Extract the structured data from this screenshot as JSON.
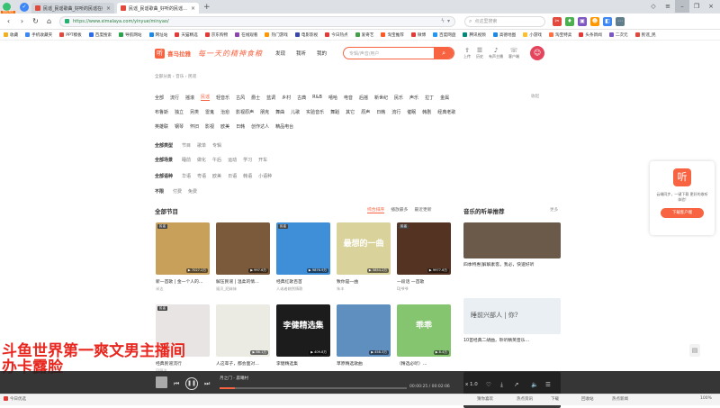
{
  "browser": {
    "brand_label": "随机浏览",
    "tabs": [
      {
        "title": "民谣_民谣歌曲_好听的民谣在线…",
        "active": false
      },
      {
        "title": "民谣_民谣歌曲_好听的民谣…",
        "active": true
      }
    ],
    "url": "https://www.ximalaya.com/yinyue/minyao/",
    "search_placeholder": "点这里搜索",
    "bookmarks": [
      {
        "label": "收藏",
        "color": "#f2b01e"
      },
      {
        "label": "手机收藏夹",
        "color": "#3d86f6"
      },
      {
        "label": "PPT模板",
        "color": "#e2483b"
      },
      {
        "label": "百度搜索",
        "color": "#2d6bea"
      },
      {
        "label": "导航网站",
        "color": "#27a44a"
      },
      {
        "label": "网址站",
        "color": "#1e88e5"
      },
      {
        "label": "天猫精选",
        "color": "#e53935"
      },
      {
        "label": "京东购物",
        "color": "#e53935"
      },
      {
        "label": "在线观看",
        "color": "#8e44ad"
      },
      {
        "label": "热门游戏",
        "color": "#ff9800"
      },
      {
        "label": "电影影视",
        "color": "#3949ab"
      },
      {
        "label": "今日热点",
        "color": "#e53935"
      },
      {
        "label": "爱奇艺",
        "color": "#43a047"
      },
      {
        "label": "淘宝推荐",
        "color": "#ff5722"
      },
      {
        "label": "微博",
        "color": "#e53935"
      },
      {
        "label": "百度网盘",
        "color": "#2196f3"
      },
      {
        "label": "腾讯视频",
        "color": "#00897b"
      },
      {
        "label": "高德地图",
        "color": "#1e88e5"
      },
      {
        "label": "小游戏",
        "color": "#fbc02d"
      },
      {
        "label": "淘宝特卖",
        "color": "#ff7043"
      },
      {
        "label": "头条新闻",
        "color": "#e53935"
      },
      {
        "label": "二次元",
        "color": "#7e57c2"
      },
      {
        "label": "民谣_民",
        "color": "#e2483b"
      }
    ]
  },
  "site": {
    "logo_glyph": "听",
    "logo_name": "喜马拉雅",
    "slogan": "每一天的精神食粮",
    "nav": [
      "发现",
      "我听",
      "我的"
    ],
    "search_placeholder": "专辑/声音/用户",
    "header_icons": [
      {
        "glyph": "⇪",
        "label": "上传"
      },
      {
        "glyph": "☰",
        "label": "历史"
      },
      {
        "glyph": "♪",
        "label": "有声主播"
      },
      {
        "glyph": "☏",
        "label": "客户端"
      }
    ],
    "avatar_glyph": "☺"
  },
  "breadcrumb": "全部分类 › 音乐 › 民谣",
  "genres_row1": [
    "全部",
    "流行",
    "摇滚",
    "民谣",
    "轻音乐",
    "古风",
    "爵士",
    "蓝调",
    "乡村",
    "古典",
    "R&B",
    "嘻哈",
    "电音",
    "后摇",
    "新世纪",
    "民乐",
    "声乐",
    "拉丁",
    "金属"
  ],
  "genres_row1_selected": "民谣",
  "genres_row2": [
    "布鲁斯",
    "独立",
    "另类",
    "雷鬼",
    "治愈",
    "影视原声",
    "朋克",
    "舞曲",
    "儿歌",
    "实验音乐",
    "舞蹈",
    "其它",
    "原声",
    "日韩",
    "流行",
    "催眠",
    "韩剧",
    "经典老歌"
  ],
  "genres_row3": [
    "英雄联",
    "钢琴",
    "怀旧",
    "影视",
    "欧美",
    "日韩",
    "创作达人",
    "精品电台"
  ],
  "expand_label": "收起",
  "filters": [
    {
      "label": "全部类型",
      "items": [
        "节目",
        "歌单",
        "专辑"
      ]
    },
    {
      "label": "全部场景",
      "items": [
        "睡前",
        "做化",
        "午后",
        "运动",
        "学习",
        "开车"
      ]
    },
    {
      "label": "全部语种",
      "items": [
        "华语",
        "粤语",
        "欧美",
        "日语",
        "韩语",
        "小语种"
      ]
    },
    {
      "label": "不限",
      "items": [
        "付费",
        "免费"
      ]
    }
  ],
  "section_all": "全部节目",
  "sort_tabs": [
    "综合排序",
    "播放最多",
    "最近更新"
  ],
  "sort_selected": "综合排序",
  "cards": [
    {
      "title": "新一首歌 | 金一个人的…",
      "author": "米达",
      "plays": "7027.2万",
      "bg": "#c8a05a",
      "tag": "民谣",
      "cover_text": ""
    },
    {
      "title": "解压民谣 | 温柔的情…",
      "author": "福贝_陌妹妹",
      "plays": "997.6万",
      "bg": "#7a5a3a",
      "tag": "",
      "cover_text": ""
    },
    {
      "title": "经典红歌百首",
      "author": "人或者婉然情歌",
      "plays": "9876.9万",
      "bg": "#3f8fd8",
      "tag": "民谣",
      "cover_text": ""
    },
    {
      "title": "致你是一曲",
      "author": "朱丰",
      "plays": "5854.2万",
      "bg": "#d9d29a",
      "tag": "",
      "cover_text": "最想的一曲"
    },
    {
      "title": "一段话 一首歌",
      "author": "DJ爷爷",
      "plays": "9977.6万",
      "bg": "#553322",
      "tag": "民谣",
      "cover_text": ""
    },
    {
      "title": "经典民谣流行",
      "author": "贝丽达",
      "plays": "",
      "bg": "#e9e4e4",
      "tag": "民谣",
      "cover_text": ""
    },
    {
      "title": "人这辈子，都会面对…",
      "author": "",
      "plays": "86.1万",
      "bg": "#ecebe3",
      "tag": "",
      "cover_text": ""
    },
    {
      "title": "李健精选集",
      "author": "",
      "plays": "409.8万",
      "bg": "#1c1c1c",
      "tag": "",
      "cover_text": "李健精选集"
    },
    {
      "title": "草原精选歌曲",
      "author": "",
      "plays": "458.3万",
      "bg": "#5f8fbf",
      "tag": "",
      "cover_text": ""
    },
    {
      "title": "（精选必听）…",
      "author": "",
      "plays": "8.4万",
      "bg": "#86c56f",
      "tag": "",
      "cover_text": "乖乖"
    }
  ],
  "section_rec": "音乐的听单推荐",
  "more_label": "更多",
  "recs": [
    {
      "title": "四季特惠|解解素客。我必，快速好听",
      "bg": "#6b5a4a",
      "cover_text": ""
    },
    {
      "title": "10首经典二胡曲，聆听精英音乐…",
      "bg": "#e9eff2",
      "cover_text": "睡前兴部人 | 你?"
    },
    {
      "title": "",
      "bg": "#3a3a3a",
      "cover_text": ""
    }
  ],
  "side_ad": {
    "glyph": "听",
    "text": "云端同步，一键下载 更好的收听体验!",
    "button": "下载客户端"
  },
  "overlay_lines": [
    "斗鱼世界第一爽文男主播间",
    "办卡露脸"
  ],
  "player": {
    "title": "月之门 - 晨曦村",
    "play_glyph": "❚❚",
    "progress": 0.08,
    "time": "00:00:25 / 00:02:06",
    "speed": "x 1.0"
  },
  "status": {
    "left": "今日优选",
    "items": [
      "猜你喜欢",
      "热点资讯",
      "下载",
      "回收站",
      "热点新闻"
    ],
    "zoom": "100%"
  }
}
